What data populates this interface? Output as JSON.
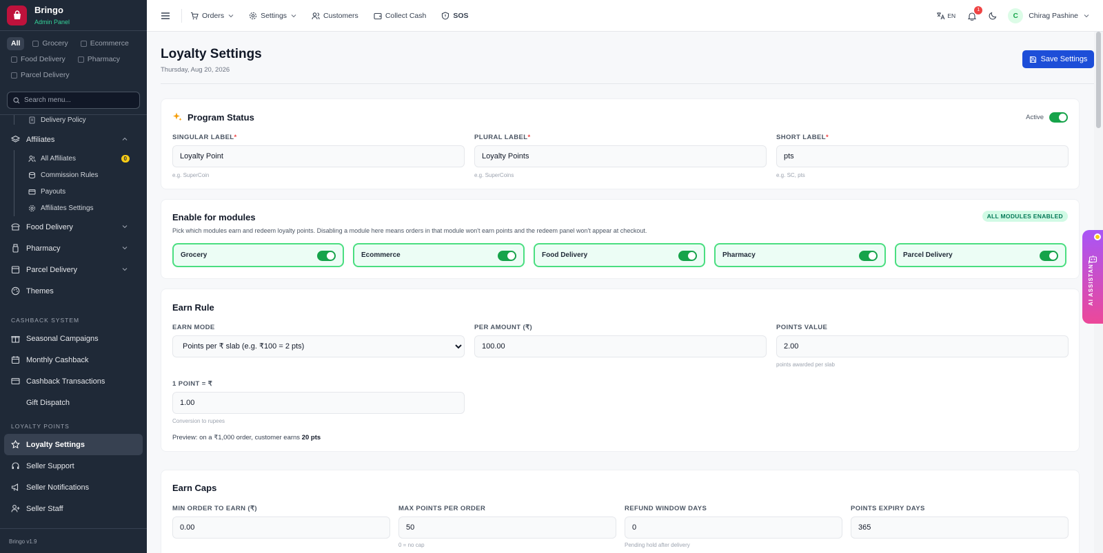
{
  "brand": {
    "name": "Bringo",
    "subtitle": "Admin Panel",
    "version": "Bringo v1.9"
  },
  "sidebar": {
    "filters": [
      {
        "label": "All",
        "active": true
      },
      {
        "label": "Grocery"
      },
      {
        "label": "Ecommerce"
      },
      {
        "label": "Food Delivery"
      },
      {
        "label": "Pharmacy"
      },
      {
        "label": "Parcel Delivery"
      }
    ],
    "search_placeholder": "Search menu...",
    "delivery_policy": "Delivery Policy",
    "affiliates": {
      "label": "Affiliates",
      "items": [
        "All Affiliates",
        "Commission Rules",
        "Payouts",
        "Affiliates Settings"
      ],
      "all_affiliates_count": "0"
    },
    "food_delivery": "Food Delivery",
    "pharmacy": "Pharmacy",
    "parcel_delivery": "Parcel Delivery",
    "themes": "Themes",
    "cashback_section": "CASHBACK SYSTEM",
    "cashback_items": [
      "Seasonal Campaigns",
      "Monthly Cashback",
      "Cashback Transactions",
      "Gift Dispatch"
    ],
    "loyalty_section": "LOYALTY POINTS",
    "loyalty_settings": "Loyalty Settings",
    "seller_items": [
      "Seller Support",
      "Seller Notifications",
      "Seller Staff"
    ]
  },
  "topbar": {
    "orders": "Orders",
    "settings": "Settings",
    "customers": "Customers",
    "collect_cash": "Collect Cash",
    "sos": "SOS",
    "lang": "EN",
    "notif_count": "1",
    "user_initial": "C",
    "user_name": "Chirag Pashine"
  },
  "page": {
    "title": "Loyalty Settings",
    "date": "Thursday, Aug 20, 2026",
    "save_label": "Save Settings"
  },
  "program_status": {
    "title": "Program Status",
    "active_label": "Active",
    "active": true,
    "singular_label": "SINGULAR LABEL",
    "singular_value": "Loyalty Point",
    "singular_hint": "e.g. SuperCoin",
    "plural_label": "PLURAL LABEL",
    "plural_value": "Loyalty Points",
    "plural_hint": "e.g. SuperCoins",
    "short_label": "SHORT LABEL",
    "short_value": "pts",
    "short_hint": "e.g. SC, pts"
  },
  "modules": {
    "title": "Enable for modules",
    "badge": "ALL MODULES ENABLED",
    "description": "Pick which modules earn and redeem loyalty points. Disabling a module here means orders in that module won't earn points and the redeem panel won't appear at checkout.",
    "items": [
      "Grocery",
      "Ecommerce",
      "Food Delivery",
      "Pharmacy",
      "Parcel Delivery"
    ]
  },
  "earn_rule": {
    "title": "Earn Rule",
    "mode_label": "EARN MODE",
    "mode_value": "Points per ₹ slab (e.g. ₹100 = 2 pts)",
    "per_amount_label": "PER AMOUNT (₹)",
    "per_amount_value": "100.00",
    "points_value_label": "POINTS VALUE",
    "points_value": "2.00",
    "points_value_hint": "points awarded per slab",
    "point_rupee_label": "1 POINT = ₹",
    "point_rupee_value": "1.00",
    "point_rupee_hint": "Conversion to rupees",
    "preview_prefix": "Preview: on a ₹1,000 order, customer earns ",
    "preview_value": "20 pts"
  },
  "earn_caps": {
    "title": "Earn Caps",
    "min_order_label": "MIN ORDER TO EARN (₹)",
    "min_order_value": "0.00",
    "max_points_label": "MAX POINTS PER ORDER",
    "max_points_value": "50",
    "max_points_hint": "0 = no cap",
    "refund_label": "REFUND WINDOW DAYS",
    "refund_value": "0",
    "refund_hint": "Pending hold after delivery",
    "expiry_label": "POINTS EXPIRY DAYS",
    "expiry_value": "365"
  },
  "ai_assistant": {
    "label": "AI ASSISTANT"
  },
  "colors": {
    "sidebar_bg": "#1f2937",
    "accent": "#1d4ed8",
    "toggle_on": "#16a34a",
    "module_border": "#4ade80",
    "brand": "#be123c"
  }
}
